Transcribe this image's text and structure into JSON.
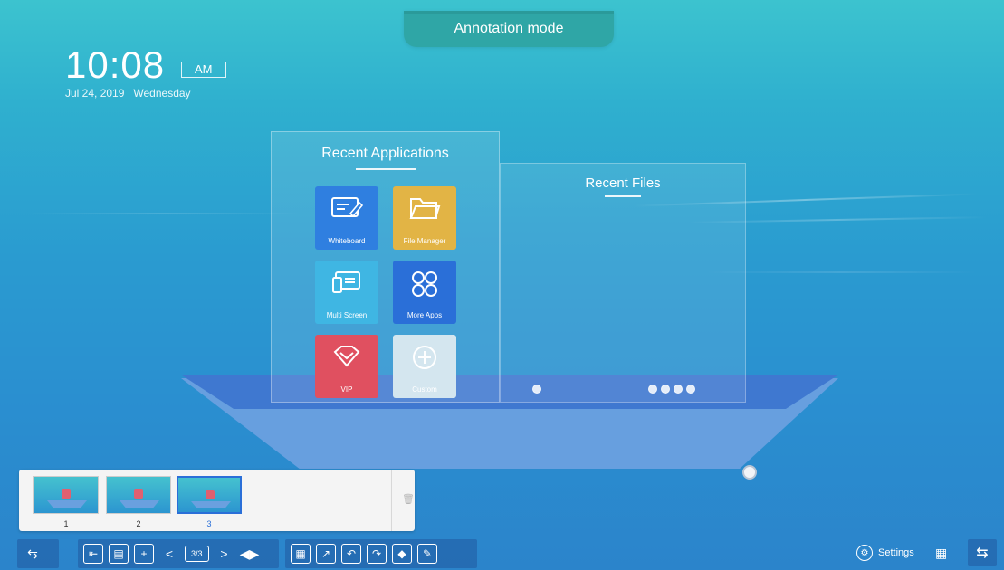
{
  "annotation_tab": {
    "label": "Annotation mode"
  },
  "clock": {
    "time": "10:08",
    "ampm": "AM",
    "date": "Jul 24, 2019",
    "weekday": "Wednesday"
  },
  "recent_apps": {
    "title": "Recent Applications",
    "apps": [
      {
        "label": "Whiteboard",
        "icon": "whiteboard-icon",
        "color": "#2f7fe0"
      },
      {
        "label": "File Manager",
        "icon": "folder-icon",
        "color": "#e2b445"
      },
      {
        "label": "Multi Screen",
        "icon": "multi-screen-icon",
        "color": "#3fb6e3"
      },
      {
        "label": "More Apps",
        "icon": "more-apps-icon",
        "color": "#2a6fd8"
      },
      {
        "label": "VIP",
        "icon": "vip-icon",
        "color": "#e05060"
      },
      {
        "label": "Custom",
        "icon": "plus-icon",
        "color": "#d4e6ef"
      }
    ]
  },
  "recent_files": {
    "title": "Recent Files"
  },
  "thumbnails": {
    "pages": [
      "1",
      "2",
      "3"
    ],
    "active_index": 2
  },
  "toolbar": {
    "page_indicator": "3/3",
    "settings_label": "Settings"
  }
}
